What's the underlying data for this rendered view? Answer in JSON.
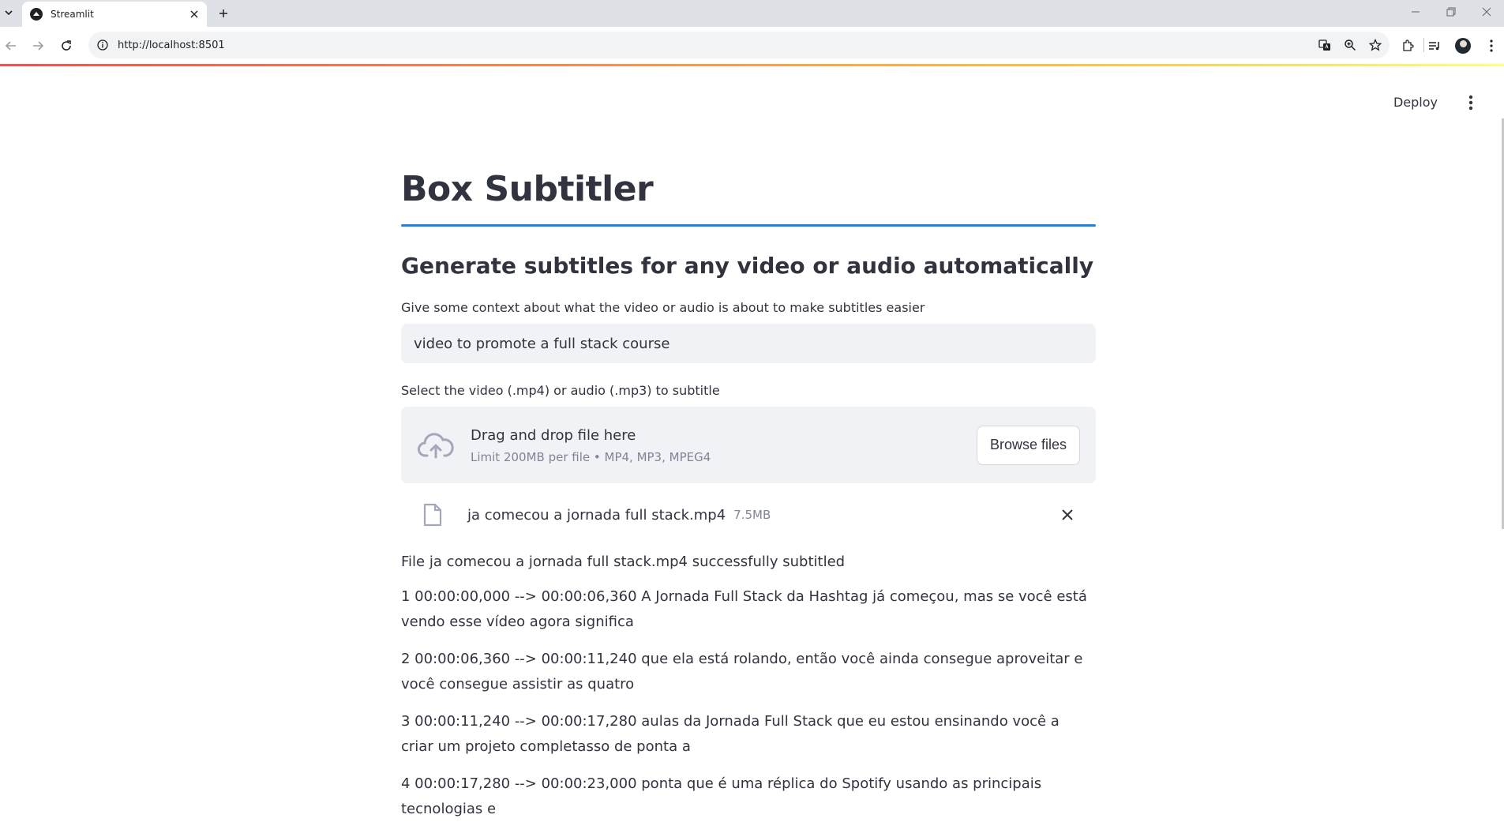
{
  "browser": {
    "tab_title": "Streamlit",
    "url": "http://localhost:8501"
  },
  "app": {
    "deploy_label": "Deploy",
    "title": "Box Subtitler",
    "subtitle": "Generate subtitles for any video or audio automatically",
    "context_label": "Give some context about what the video or audio is about to make subtitles easier",
    "context_value": "video to promote a full stack course",
    "uploader_label": "Select the video (.mp4) or audio (.mp3) to subtitle",
    "dropzone_primary": "Drag and drop file here",
    "dropzone_secondary": "Limit 200MB per file • MP4, MP3, MPEG4",
    "browse_label": "Browse files",
    "uploaded_file": {
      "name": "ja comecou a jornada full stack.mp4",
      "size": "7.5MB"
    },
    "success_message": "File ja comecou a jornada full stack.mp4 successfully subtitled",
    "subtitles": [
      "1 00:00:00,000 --> 00:00:06,360 A Jornada Full Stack da Hashtag já começou, mas se você está vendo esse vídeo agora significa",
      "2 00:00:06,360 --> 00:00:11,240 que ela está rolando, então você ainda consegue aproveitar e você consegue assistir as quatro",
      "3 00:00:11,240 --> 00:00:17,280 aulas da Jornada Full Stack que eu estou ensinando você a criar um projeto completasso de ponta a",
      "4 00:00:17,280 --> 00:00:23,000 ponta que é uma réplica do Spotify usando as principais tecnologias e"
    ]
  },
  "colors": {
    "accent": "#1c83e1",
    "decoration_start": "#ff4b4b",
    "decoration_end": "#fffd80",
    "input_bg": "#f0f2f6",
    "text": "#31333f",
    "muted": "#808495"
  },
  "icons": [
    "tab-list-icon",
    "streamlit-favicon",
    "close-icon",
    "plus-icon",
    "minimize-icon",
    "restore-icon",
    "back-icon",
    "forward-icon",
    "reload-icon",
    "info-icon",
    "translate-icon",
    "zoom-icon",
    "star-icon",
    "extensions-icon",
    "media-icon",
    "avatar",
    "more-vert-icon",
    "cloud-upload-icon",
    "file-icon"
  ]
}
